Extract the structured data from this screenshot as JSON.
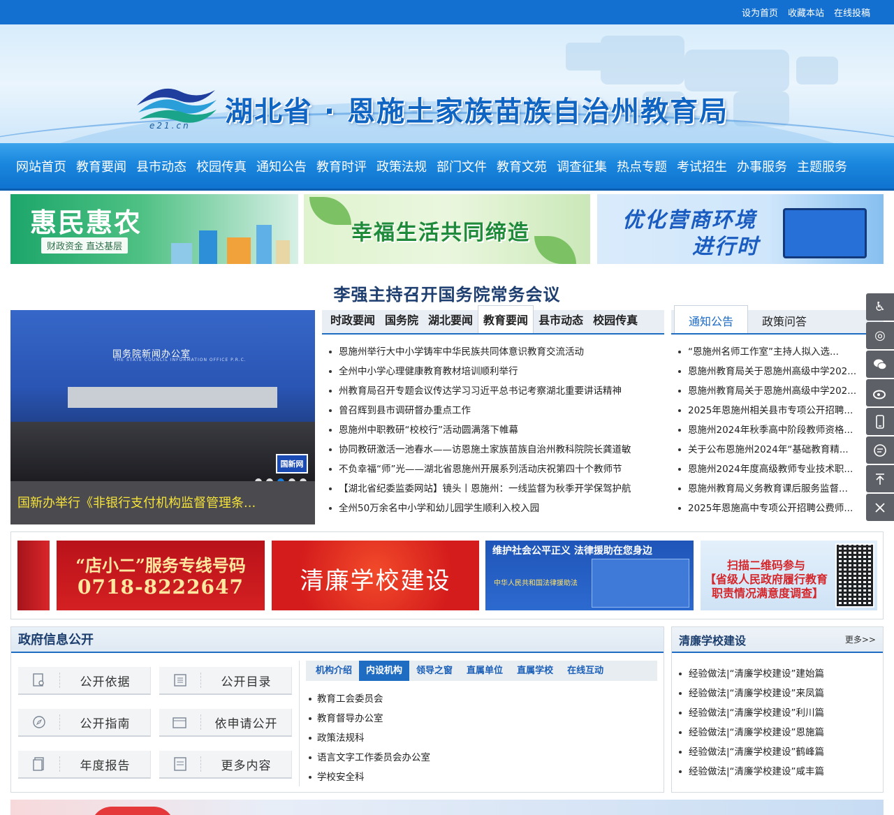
{
  "topbar": {
    "links": [
      "设为首页",
      "收藏本站",
      "在线投稿"
    ]
  },
  "header": {
    "title": "湖北省 · 恩施土家族苗族自治州教育局",
    "logo_text": "e21.cn"
  },
  "nav": {
    "items": [
      "网站首页",
      "教育要闻",
      "县市动态",
      "校园传真",
      "通知公告",
      "教育时评",
      "政策法规",
      "部门文件",
      "教育文苑",
      "调查征集",
      "热点专题",
      "考试招生",
      "办事服务",
      "主题服务"
    ]
  },
  "promos": {
    "p1_big": "惠民惠农",
    "p1_small": "财政资金  直达基层",
    "p2_big": "幸福生活共同缔造",
    "p3_line1": "优化营商环境",
    "p3_line2": "进行时"
  },
  "headline": "李强主持召开国务院常务会议",
  "slider": {
    "caption": "国新办举行《非银行支付机构监督管理条...",
    "wall_text": "国务院新闻办公室",
    "wall_sub": "THE STATE COUNCIL INFORMATION OFFICE P.R.C.",
    "badge": "国新网",
    "active_dot": 3
  },
  "news": {
    "tabs": [
      "时政要闻",
      "国务院",
      "湖北要闻",
      "教育要闻",
      "县市动态",
      "校园传真"
    ],
    "active_tab": "教育要闻",
    "items": [
      "恩施州举行大中小学铸牢中华民族共同体意识教育交流活动",
      "全州中小学心理健康教育教材培训顺利举行",
      "州教育局召开专题会议传达学习习近平总书记考察湖北重要讲话精神",
      "曾召辉到县市调研督办重点工作",
      "恩施州中职教研“校校行”活动圆满落下帷幕",
      "协同教研激活一池春水——访恩施土家族苗族自治州教科院院长龚道敏",
      "不负幸福“师”光——湖北省恩施州开展系列活动庆祝第四十个教师节",
      "【湖北省纪委监委网站】镜头丨恩施州：一线监督为秋季开学保驾护航",
      "全州50万余名中小学和幼儿园学生顺利入校入园"
    ]
  },
  "notice": {
    "tabs": [
      "通知公告",
      "政策问答"
    ],
    "active_tab": "通知公告",
    "items": [
      "“恩施州名师工作室”主持人拟入选...",
      "恩施州教育局关于恩施州高级中学202...",
      "恩施州教育局关于恩施州高级中学202...",
      "2025年恩施州相关县市专项公开招聘...",
      "恩施州2024年秋季高中阶段教师资格...",
      "关于公布恩施州2024年“基础教育精...",
      "恩施州2024年度高级教师专业技术职...",
      "恩施州教育局义务教育课后服务监督...",
      "2025年恩施高中专项公开招聘公费师..."
    ]
  },
  "sidebar": {
    "icons": [
      "accessibility-icon",
      "elder-mode-icon",
      "wechat-icon",
      "weibo-icon",
      "mobile-icon",
      "message-icon",
      "back-to-top-icon",
      "close-icon"
    ]
  },
  "ads": {
    "ad1_line1": "“店小二”服务专线号码",
    "ad1_line2": "0718-8222647",
    "ad2": "清廉学校建设",
    "ad3_title": "维护社会公平正义  法律援助在您身边",
    "ad3_sub": "中华人民共和国法律援助法",
    "ad4_line1": "扫描二维码参与",
    "ad4_line2": "【省级人民政府履行教育",
    "ad4_line3": "职责情况满意度调查】"
  },
  "gov": {
    "title": "政府信息公开",
    "buttons": [
      {
        "label": "公开依据",
        "icon": "document-search-icon"
      },
      {
        "label": "公开目录",
        "icon": "list-icon"
      },
      {
        "label": "公开指南",
        "icon": "compass-icon"
      },
      {
        "label": "依申请公开",
        "icon": "window-icon"
      },
      {
        "label": "年度报告",
        "icon": "report-icon"
      },
      {
        "label": "更多内容",
        "icon": "more-icon"
      }
    ],
    "org_tabs": [
      "机构介绍",
      "内设机构",
      "领导之窗",
      "直属单位",
      "直属学校",
      "在线互动"
    ],
    "org_active": "内设机构",
    "org_items": [
      "教育工会委员会",
      "教育督导办公室",
      "政策法规科",
      "语言文字工作委员会办公室",
      "学校安全科"
    ]
  },
  "clean": {
    "title": "清廉学校建设",
    "more": "更多>>",
    "items": [
      "经验做法|“清廉学校建设”建始篇",
      "经验做法|“清廉学校建设”来凤篇",
      "经验做法|“清廉学校建设”利川篇",
      "经验做法|“清廉学校建设”恩施篇",
      "经验做法|“清廉学校建设”鹤峰篇",
      "经验做法|“清廉学校建设”咸丰篇"
    ]
  }
}
